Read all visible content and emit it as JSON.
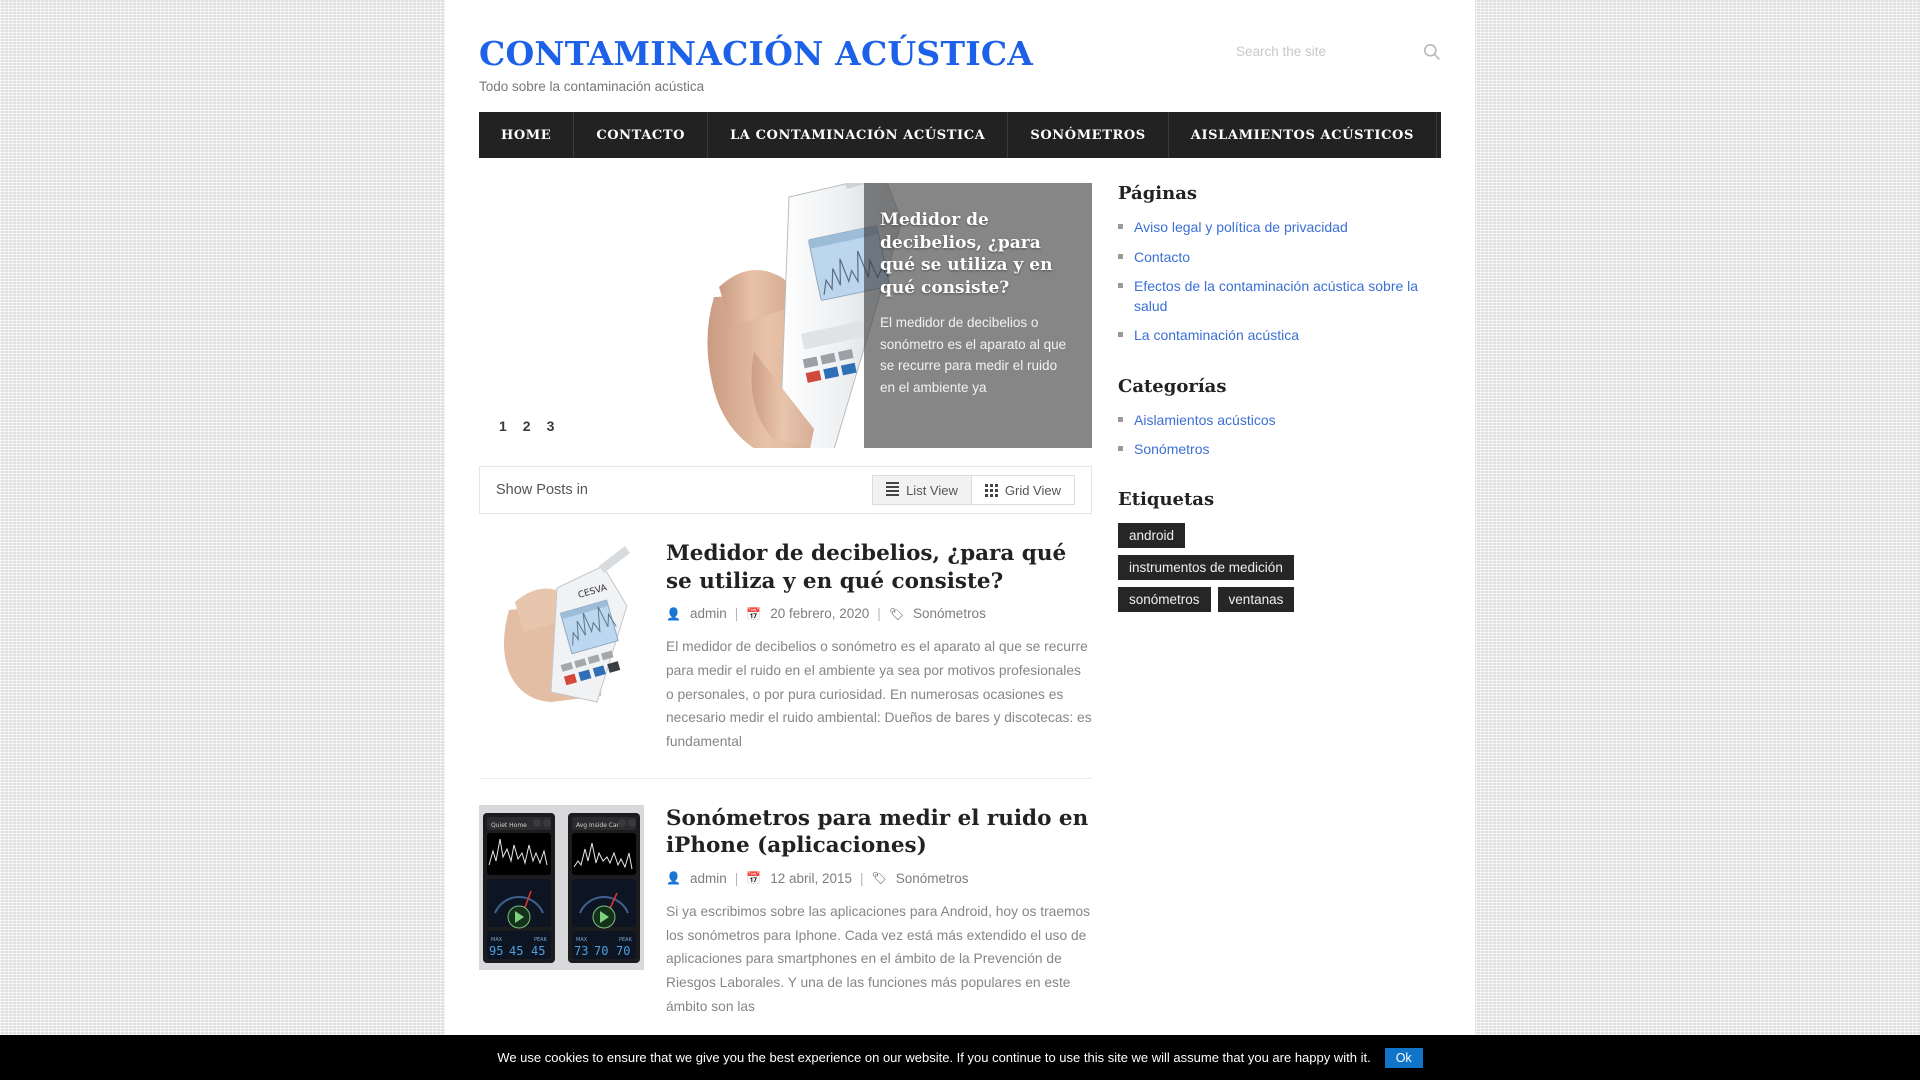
{
  "header": {
    "site_title": "CONTAMINACIÓN ACÚSTICA",
    "tagline": "Todo sobre la contaminación acústica",
    "search_placeholder": "Search the site",
    "search_value": "",
    "search_icon": "search-icon"
  },
  "nav": {
    "items": [
      {
        "label": "HOME"
      },
      {
        "label": "CONTACTO"
      },
      {
        "label": "LA CONTAMINACIÓN ACÚSTICA"
      },
      {
        "label": "SONÓMETROS"
      },
      {
        "label": "AISLAMIENTOS ACÚSTICOS"
      }
    ]
  },
  "slider": {
    "title": "Medidor de decibelios, ¿para qué se utiliza y en qué consiste?",
    "excerpt": "El medidor de decibelios o sonómetro es el aparato al que se recurre para medir el ruido en el ambiente ya",
    "dots": [
      "1",
      "2",
      "3"
    ],
    "active_dot": "1"
  },
  "view_bar": {
    "label": "Show Posts in",
    "list_label": "List View",
    "grid_label": "Grid View",
    "active": "List View"
  },
  "posts": [
    {
      "title": "Medidor de decibelios, ¿para qué se utiliza y en qué consiste?",
      "author": "admin",
      "date": "20 febrero, 2020",
      "category": "Sonómetros",
      "excerpt": "El medidor de decibelios o sonómetro es el aparato al que se recurre para medir el ruido en el ambiente ya sea por motivos profesionales o personales, o por pura curiosidad. En numerosas ocasiones es necesario medir el ruido ambiental: Dueños de bares y discotecas: es fundamental",
      "thumb": "sound-level-meter-photo"
    },
    {
      "title": "Sonómetros para medir el ruido en iPhone (aplicaciones)",
      "author": "admin",
      "date": "12 abril, 2015",
      "category": "Sonómetros",
      "excerpt": "Si ya escribimos sobre las aplicaciones para Android, hoy os traemos los sonómetros para Iphone. Cada vez está más extendido el uso de aplicaciones para smartphones en el ámbito de la Prevención de Riesgos Laborales. Y  una de las funciones más populares en este ámbito son las",
      "thumb": "iphone-decibel-app-photo"
    }
  ],
  "sidebar": {
    "pages": {
      "title": "Páginas",
      "items": [
        {
          "label": "Aviso legal y política de privacidad"
        },
        {
          "label": "Contacto"
        },
        {
          "label": "Efectos de la contaminación acústica sobre la salud"
        },
        {
          "label": "La contaminación acústica"
        }
      ]
    },
    "categories": {
      "title": "Categorías",
      "items": [
        {
          "label": "Aislamientos acústicos"
        },
        {
          "label": "Sonómetros"
        }
      ]
    },
    "tags": {
      "title": "Etiquetas",
      "items": [
        {
          "label": "android"
        },
        {
          "label": "instrumentos de medición"
        },
        {
          "label": "sonómetros"
        },
        {
          "label": "ventanas"
        }
      ]
    }
  },
  "cookie": {
    "text": "We use cookies to ensure that we give you the best experience on our website. If you continue to use this site we will assume that you are happy with it.",
    "ok_label": "Ok"
  },
  "colors": {
    "brand_blue": "#1d61e8",
    "link_blue": "#3b6fd4",
    "nav_dark": "#222222",
    "tag_dark": "#262626",
    "cookie_button": "#1074c8"
  }
}
